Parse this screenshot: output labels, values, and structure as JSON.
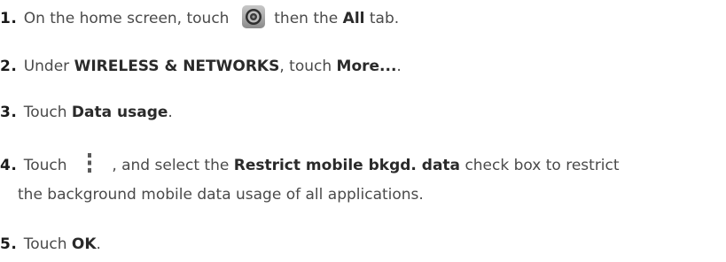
{
  "steps": [
    {
      "number": "1.",
      "text_a": "On the home screen, touch",
      "icon": "settings-gear-icon",
      "text_b": "then the",
      "bold_a": "All",
      "text_c": "tab."
    },
    {
      "number": "2.",
      "text_a": "Under",
      "bold_a": "WIRELESS & NETWORKS",
      "text_b": ", touch",
      "bold_b": "More...",
      "text_c": "."
    },
    {
      "number": "3.",
      "text_a": "Touch",
      "bold_a": "Data usage",
      "text_b": "."
    },
    {
      "number": "4.",
      "text_a": "Touch",
      "icon": "menu-dots-icon",
      "text_b": ", and select the",
      "bold_a": "Restrict mobile bkgd. data",
      "text_c": "check box to restrict",
      "text_d": "the background mobile data usage of all applications."
    },
    {
      "number": "5.",
      "text_a": "Touch",
      "bold_a": "OK",
      "text_b": "."
    }
  ]
}
